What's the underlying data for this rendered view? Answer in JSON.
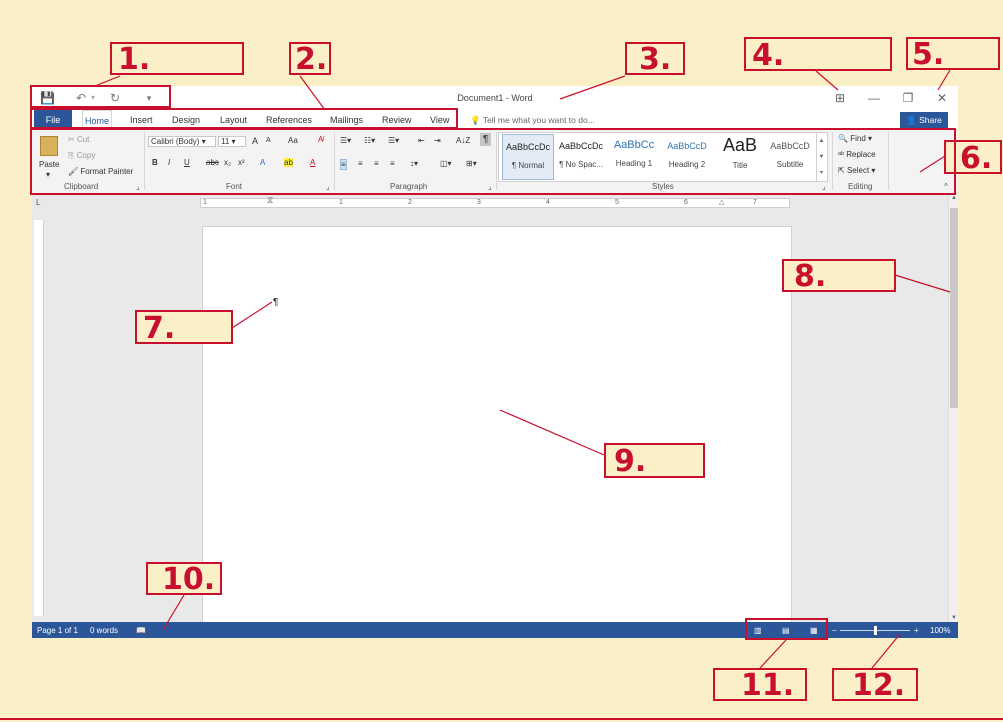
{
  "annotations": [
    "1.",
    "2.",
    "3.",
    "4.",
    "5.",
    "6.",
    "7.",
    "8.",
    "9.",
    "10.",
    "11.",
    "12."
  ],
  "window": {
    "title": "Document1 - Word",
    "qat": [
      "save-icon",
      "undo-icon",
      "redo-icon",
      "customize-icon"
    ],
    "controls": {
      "display_options": "⊞",
      "minimize": "—",
      "restore": "❐",
      "close": "✕"
    }
  },
  "tabs": {
    "file": "File",
    "items": [
      "Home",
      "Insert",
      "Design",
      "Layout",
      "References",
      "Mailings",
      "Review",
      "View"
    ],
    "tell_me": "Tell me what you want to do...",
    "share": "Share"
  },
  "ribbon": {
    "clipboard": {
      "paste": "Paste",
      "cut": "Cut",
      "copy": "Copy",
      "format_painter": "Format Painter",
      "label": "Clipboard"
    },
    "font": {
      "name": "Calibri (Body)",
      "size": "11",
      "grow": "A",
      "shrink": "A",
      "case": "Aa",
      "bold": "B",
      "italic": "I",
      "underline": "U",
      "strike": "abc",
      "sub": "x₂",
      "sup": "x²",
      "effects": "A",
      "highlight": "ab",
      "color": "A",
      "label": "Font"
    },
    "paragraph": {
      "label": "Paragraph",
      "sort": "A↓Z",
      "pilcrow": "¶"
    },
    "styles": {
      "label": "Styles",
      "items": [
        {
          "sample": "AaBbCcDc",
          "name": "¶ Normal"
        },
        {
          "sample": "AaBbCcDc",
          "name": "¶ No Spac..."
        },
        {
          "sample": "AaBbCc",
          "name": "Heading 1"
        },
        {
          "sample": "AaBbCcD",
          "name": "Heading 2"
        },
        {
          "sample": "AaB",
          "name": "Title"
        },
        {
          "sample": "AaBbCcD",
          "name": "Subtitle"
        }
      ]
    },
    "editing": {
      "find": "Find",
      "replace": "Replace",
      "select": "Select",
      "label": "Editing"
    }
  },
  "ruler": {
    "marks": [
      "1",
      "1",
      "2",
      "3",
      "4",
      "5",
      "6",
      "7"
    ]
  },
  "document": {
    "mark": "¶"
  },
  "status": {
    "page": "Page 1 of 1",
    "words": "0 words",
    "zoom": "100%",
    "zoom_level_percent": 100
  },
  "colors": {
    "annotation": "#c8102e",
    "background": "#fbefc7",
    "word_blue": "#2b579a"
  }
}
